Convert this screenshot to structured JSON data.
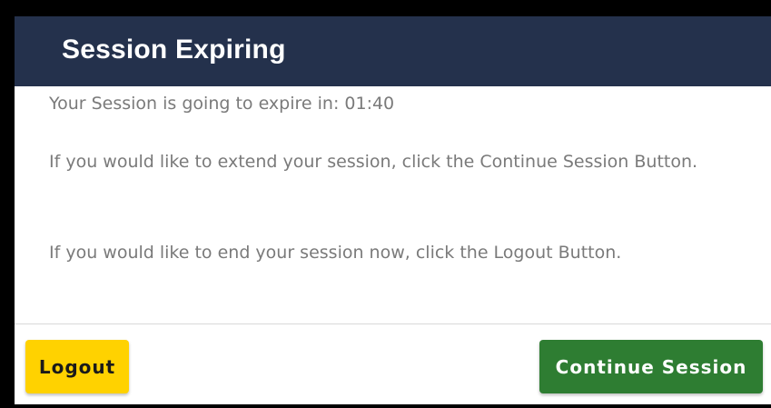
{
  "dialog": {
    "title": "Session Expiring",
    "messages": {
      "expire_line": "Your Session is going to expire in: 01:40",
      "extend_line": "If you would like to extend your session, click the Continue Session Button.",
      "logout_line": "If you would like to end your session now, click the Logout Button."
    },
    "buttons": {
      "logout_label": "Logout",
      "continue_label": "Continue Session"
    }
  },
  "colors": {
    "header_bg": "#24314c",
    "logout_bg": "#ffd200",
    "continue_bg": "#2e7d32",
    "body_text": "#7a7a7a"
  }
}
